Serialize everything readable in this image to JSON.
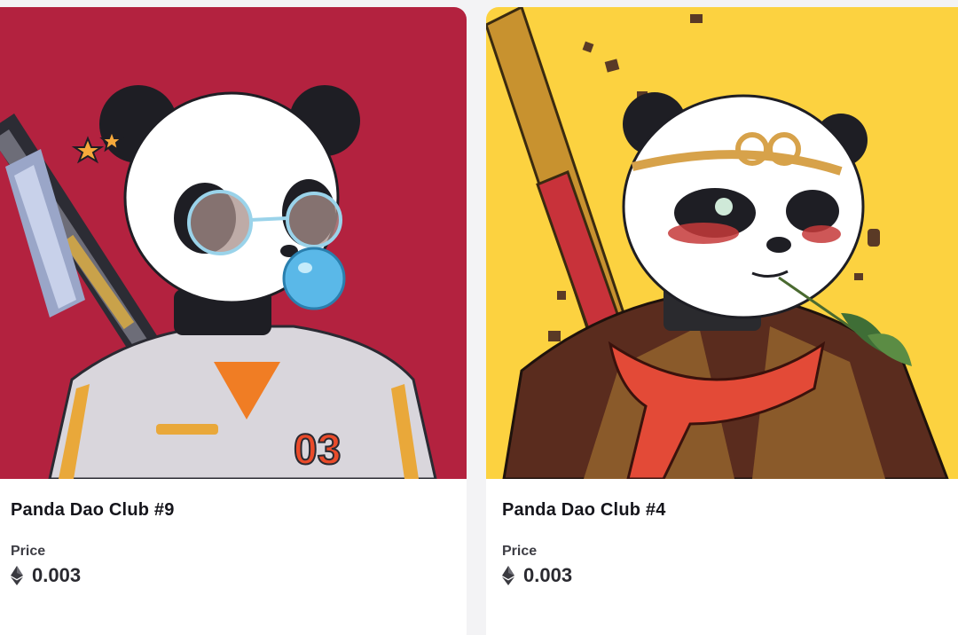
{
  "cards": [
    {
      "title": "Panda Dao Club #9",
      "price_label": "Price",
      "price": "0.003",
      "currency_icon": "ethereum-icon",
      "background": "#b3223f",
      "jersey_number": "03"
    },
    {
      "title": "Panda Dao Club #4",
      "price_label": "Price",
      "price": "0.003",
      "currency_icon": "ethereum-icon",
      "background": "#fcd240"
    }
  ]
}
